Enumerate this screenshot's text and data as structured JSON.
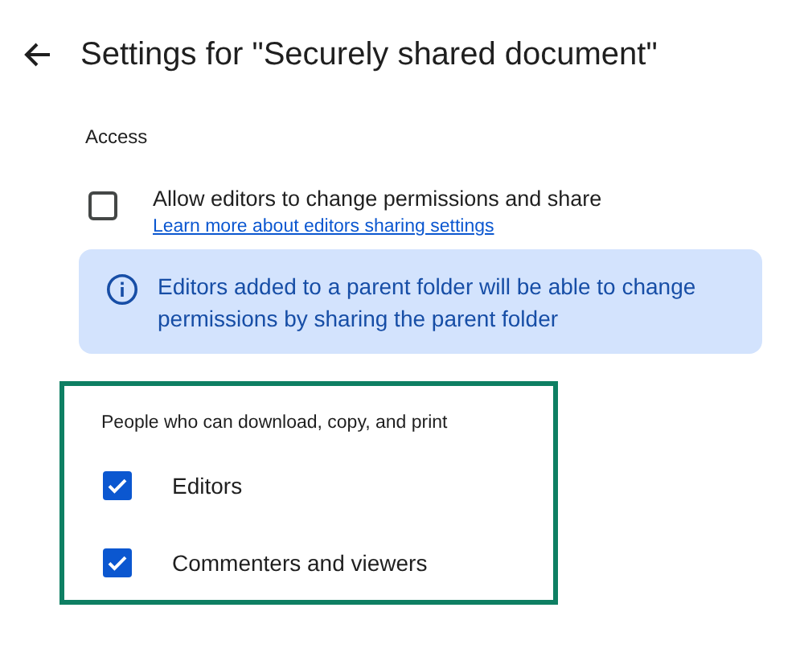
{
  "header": {
    "title": "Settings for \"Securely shared document\""
  },
  "access": {
    "heading": "Access",
    "option": {
      "label": "Allow editors to change permissions and share",
      "link": "Learn more about editors sharing settings",
      "checked": false
    },
    "info": "Editors added to a parent folder will be able to change permissions by sharing the parent folder"
  },
  "download_section": {
    "heading": "People who can download, copy, and print",
    "options": [
      {
        "label": "Editors",
        "checked": true
      },
      {
        "label": "Commenters and viewers",
        "checked": true
      }
    ]
  }
}
